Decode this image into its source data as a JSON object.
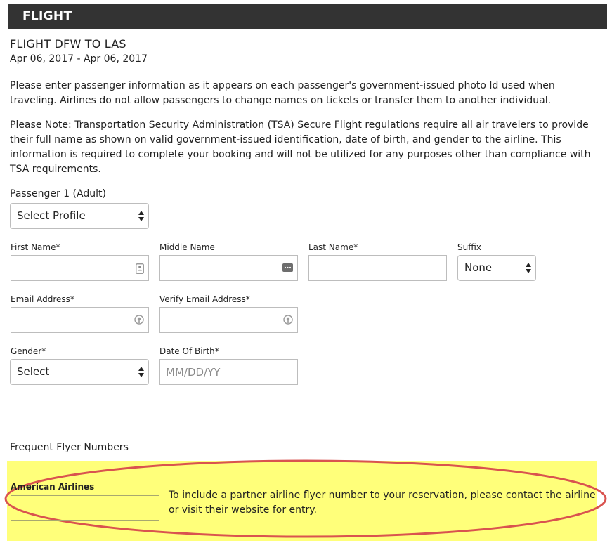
{
  "header": {
    "title": "FLIGHT"
  },
  "trip": {
    "title": "FLIGHT DFW TO LAS",
    "dates": "Apr 06, 2017 - Apr 06, 2017"
  },
  "instructions": {
    "paragraph1": "Please enter passenger information as it appears on each passenger's government-issued photo Id used when traveling. Airlines do not allow passengers to change names on tickets or transfer them to another individual.",
    "paragraph2": "Please Note: Transportation Security Administration (TSA) Secure Flight regulations require all air travelers to provide their full name as shown on valid government-issued identification, date of birth, and gender to the airline. This information is required to complete your booking and will not be utilized for any purposes other than compliance with TSA requirements."
  },
  "passenger": {
    "heading": "Passenger 1 (Adult)",
    "profile_select": "Select Profile",
    "first_name_label": "First Name*",
    "first_name_value": "",
    "middle_name_label": "Middle Name",
    "middle_name_value": "",
    "last_name_label": "Last Name*",
    "last_name_value": "",
    "suffix_label": "Suffix",
    "suffix_value": "None",
    "email_label": "Email Address*",
    "email_value": "",
    "verify_email_label": "Verify Email Address*",
    "verify_email_value": "",
    "gender_label": "Gender*",
    "gender_value": "Select",
    "dob_label": "Date Of Birth*",
    "dob_placeholder": "MM/DD/YY"
  },
  "frequent_flyer": {
    "heading": "Frequent Flyer Numbers",
    "airline_label": "American Airlines",
    "airline_value": "",
    "note": "To include a partner airline flyer number to your reservation, please contact the airline or visit their website for entry.",
    "highlight_color": "#ffff7a",
    "annotation_color": "#d9534f"
  },
  "icons": {
    "first_name": "contact-card-icon",
    "middle_name": "ellipsis-key-icon",
    "email": "autofill-key-icon",
    "verify_email": "autofill-key-icon"
  }
}
